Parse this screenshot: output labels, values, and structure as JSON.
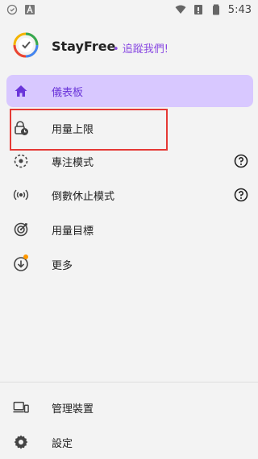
{
  "status_bar": {
    "time": "5:43",
    "icons_left": [
      "clock-circle-icon",
      "a-icon"
    ],
    "icons_right": [
      "wifi-icon",
      "sim-icon",
      "battery-icon"
    ]
  },
  "header": {
    "app_name": "StayFree",
    "tagline": "• 追蹤我們!"
  },
  "menu": {
    "items": [
      {
        "label": "儀表板",
        "icon": "home-icon",
        "active": true
      },
      {
        "label": "用量上限",
        "icon": "lock-clock-icon"
      },
      {
        "label": "專注模式",
        "icon": "focus-icon",
        "help": true
      },
      {
        "label": "倒數休止模式",
        "icon": "broadcast-icon",
        "help": true
      },
      {
        "label": "用量目標",
        "icon": "target-icon"
      },
      {
        "label": "更多",
        "icon": "download-circle-icon",
        "badge": true
      }
    ]
  },
  "bottom_menu": {
    "items": [
      {
        "label": "管理裝置",
        "icon": "devices-icon"
      },
      {
        "label": "設定",
        "icon": "gear-icon"
      }
    ]
  },
  "colors": {
    "accent": "#6a35d9",
    "active_bg": "#d8c8ff",
    "tagline": "#8a4be2",
    "highlight": "#e53935",
    "badge": "#ff9800"
  }
}
